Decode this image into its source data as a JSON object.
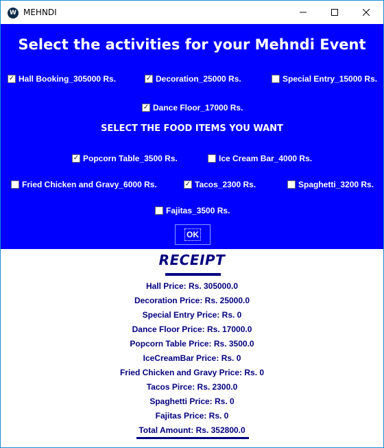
{
  "window": {
    "title": "MEHNDI",
    "icon_glyph": "W",
    "icon_name": "app-icon"
  },
  "activities": {
    "heading": "Select the activities for your Mehndi Event",
    "items": [
      {
        "label": "Hall Booking_305000 Rs.",
        "checked": true
      },
      {
        "label": "Decoration_25000 Rs.",
        "checked": true
      },
      {
        "label": "Special Entry_15000 Rs.",
        "checked": false
      },
      {
        "label": "Dance Floor_17000 Rs.",
        "checked": true
      }
    ]
  },
  "food": {
    "heading": "SELECT THE FOOD ITEMS YOU WANT",
    "items": [
      {
        "label": "Popcorn Table_3500 Rs.",
        "checked": true
      },
      {
        "label": "Ice Cream Bar_4000 Rs.",
        "checked": false
      },
      {
        "label": "Fried Chicken and Gravy_6000 Rs.",
        "checked": false
      },
      {
        "label": "Tacos_2300 Rs.",
        "checked": true
      },
      {
        "label": "Spaghetti_3200 Rs.",
        "checked": false
      },
      {
        "label": "Fajitas_3500 Rs.",
        "checked": false
      }
    ]
  },
  "ok_button": {
    "label": "OK"
  },
  "receipt": {
    "title": "RECEIPT",
    "lines": [
      "Hall Price: Rs. 305000.0",
      "Decoration Price: Rs. 25000.0",
      "Special Entry Price: Rs. 0",
      "Dance Floor Price:  Rs. 17000.0",
      "Popcorn Table Price: Rs. 3500.0",
      "IceCreamBar Price: Rs. 0",
      "Fried Chicken and Gravy Price: Rs. 0",
      "Tacos Pirce: Rs. 2300.0",
      "Spaghetti Price: Rs. 0",
      "Fajitas Price: Rs. 0"
    ],
    "total": "Total Amount: Rs. 352800.0"
  },
  "colors": {
    "panel": "#0000ff",
    "receipt_text": "#000080",
    "window_border": "#1b8bd6"
  }
}
